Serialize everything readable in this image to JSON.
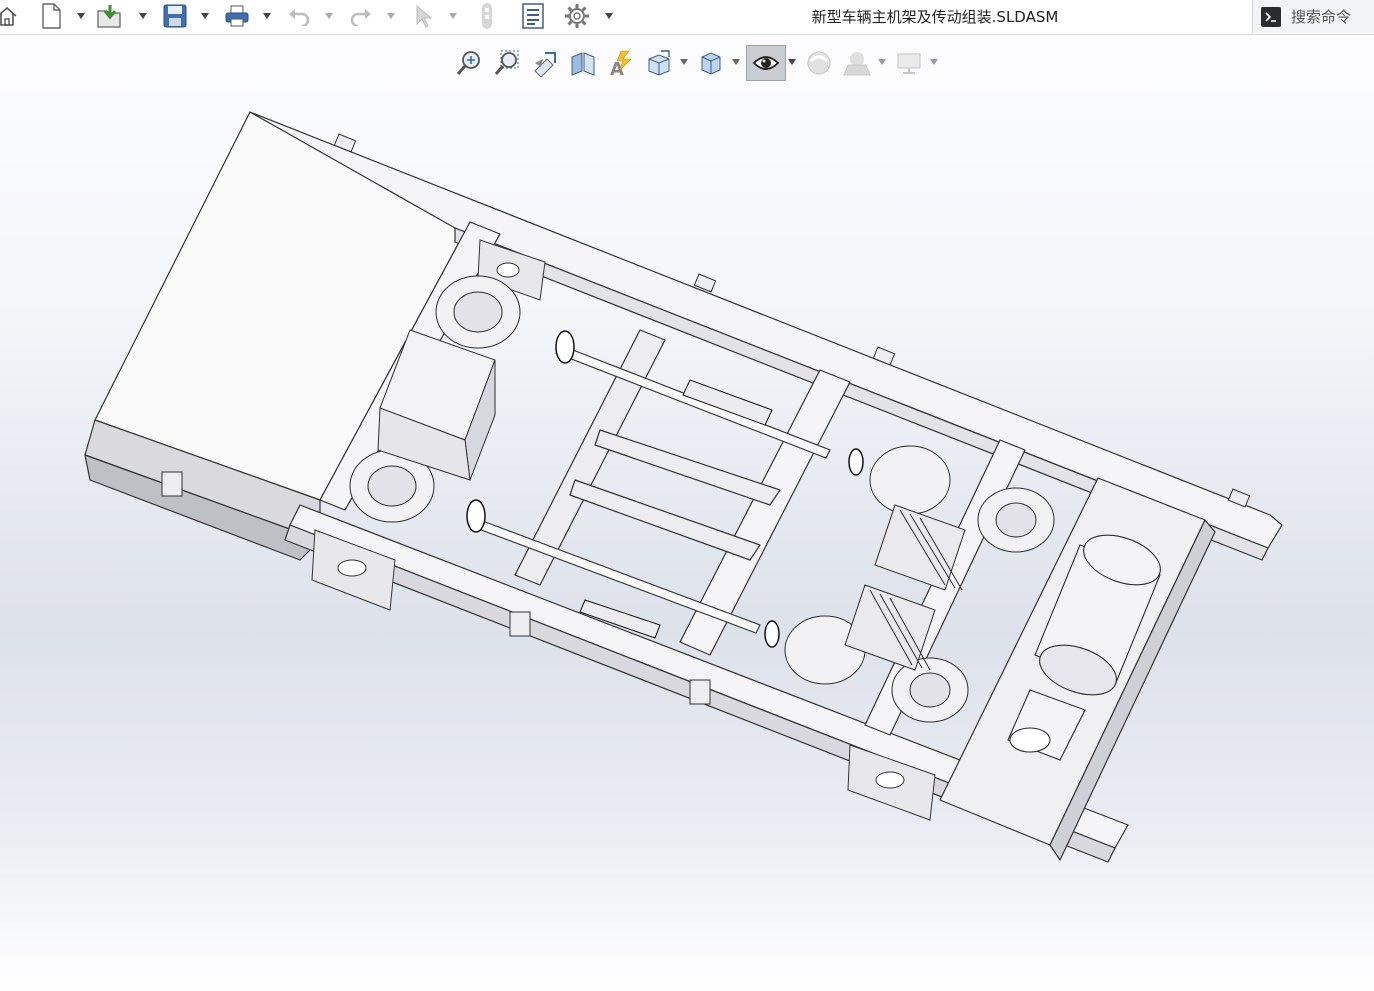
{
  "titlebar": {
    "document_title": "新型车辆主机架及传动组装.SLDASM",
    "search_placeholder": "搜索命令"
  },
  "toolbar": {
    "buttons": [
      {
        "name": "home-icon"
      },
      {
        "name": "new-document-icon"
      },
      {
        "name": "open-icon"
      },
      {
        "name": "save-icon"
      },
      {
        "name": "print-icon"
      },
      {
        "name": "undo-icon"
      },
      {
        "name": "redo-icon"
      },
      {
        "name": "select-icon"
      },
      {
        "name": "rebuild-icon"
      },
      {
        "name": "file-properties-icon"
      },
      {
        "name": "options-gear-icon"
      }
    ]
  },
  "heads_up_toolbar": {
    "buttons": [
      {
        "name": "zoom-to-fit-icon"
      },
      {
        "name": "zoom-to-area-icon"
      },
      {
        "name": "previous-view-icon"
      },
      {
        "name": "section-view-icon"
      },
      {
        "name": "dynamic-annotation-icon"
      },
      {
        "name": "view-orientation-icon"
      },
      {
        "name": "display-style-icon"
      },
      {
        "name": "hide-show-items-icon",
        "active": true
      },
      {
        "name": "edit-appearance-icon"
      },
      {
        "name": "apply-scene-icon"
      },
      {
        "name": "view-settings-icon"
      }
    ]
  },
  "model": {
    "name": "vehicle-main-frame-assembly",
    "line_color": "#3a3a3a",
    "fill_color": "#f4f4f6"
  }
}
